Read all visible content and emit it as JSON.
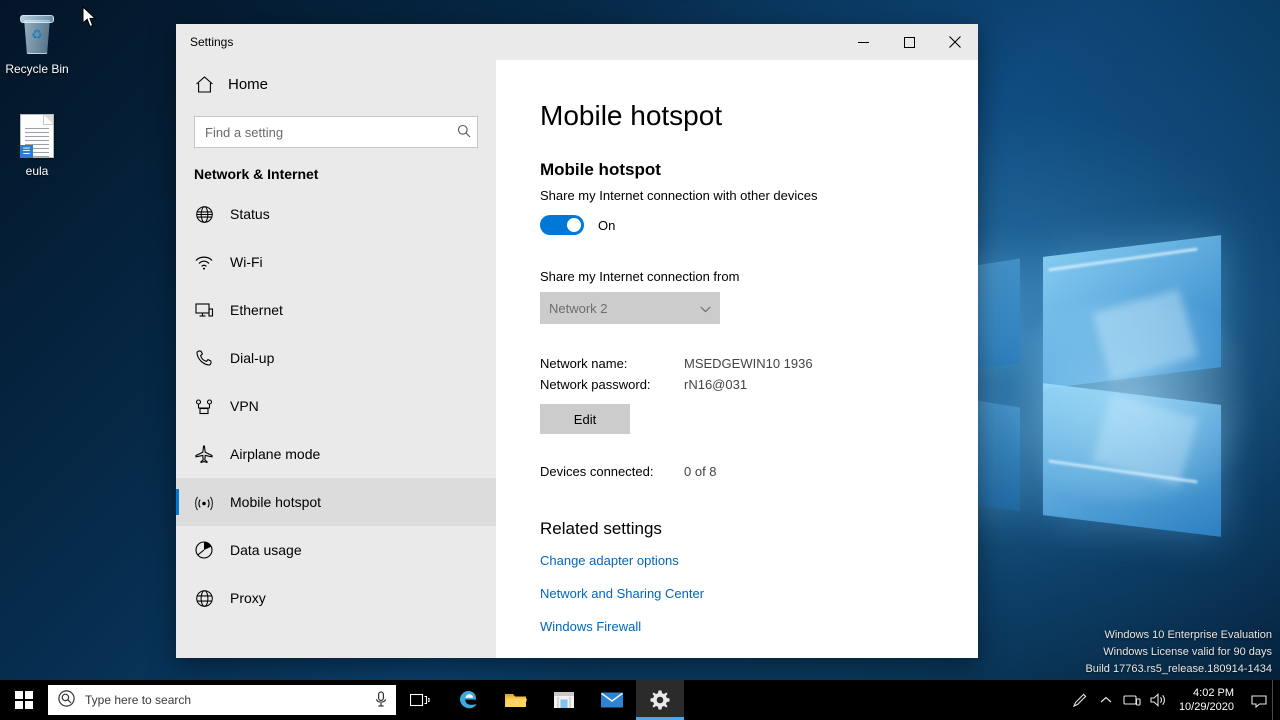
{
  "desktop": {
    "icons": [
      {
        "name": "Recycle Bin",
        "icon": "recycle-bin-icon"
      },
      {
        "name": "eula",
        "icon": "text-document-icon"
      }
    ],
    "watermark": [
      "Windows 10 Enterprise Evaluation",
      "Windows License valid for 90 days",
      "Build 17763.rs5_release.180914-1434"
    ]
  },
  "window": {
    "title": "Settings",
    "controls": {
      "minimize": "—",
      "maximize": "☐",
      "close": "✕"
    }
  },
  "sidebar": {
    "home_label": "Home",
    "search": {
      "placeholder": "Find a setting",
      "value": "",
      "icon": "search-icon"
    },
    "category": "Network & Internet",
    "items": [
      {
        "label": "Status",
        "icon": "globe-icon",
        "selected": false
      },
      {
        "label": "Wi-Fi",
        "icon": "wifi-icon",
        "selected": false
      },
      {
        "label": "Ethernet",
        "icon": "ethernet-icon",
        "selected": false
      },
      {
        "label": "Dial-up",
        "icon": "dialup-phone-icon",
        "selected": false
      },
      {
        "label": "VPN",
        "icon": "vpn-icon",
        "selected": false
      },
      {
        "label": "Airplane mode",
        "icon": "airplane-icon",
        "selected": false
      },
      {
        "label": "Mobile hotspot",
        "icon": "hotspot-broadcast-icon",
        "selected": true
      },
      {
        "label": "Data usage",
        "icon": "data-usage-pie-icon",
        "selected": false
      },
      {
        "label": "Proxy",
        "icon": "proxy-globe-icon",
        "selected": false
      }
    ]
  },
  "main": {
    "page_title": "Mobile hotspot",
    "section_heading": "Mobile hotspot",
    "section_sub": "Share my Internet connection with other devices",
    "toggle": {
      "state_label": "On",
      "on": true,
      "accent": "#0078d7"
    },
    "share_from_label": "Share my Internet connection from",
    "share_from_value": "Network 2",
    "details": [
      {
        "key": "Network name:",
        "value": "MSEDGEWIN10 1936"
      },
      {
        "key": "Network password:",
        "value": "rN16@031"
      }
    ],
    "edit_button": "Edit",
    "devices": {
      "key": "Devices connected:",
      "value": "0 of 8"
    },
    "related_title": "Related settings",
    "related_links": [
      "Change adapter options",
      "Network and Sharing Center",
      "Windows Firewall"
    ],
    "link_color": "#0067b8"
  },
  "taskbar": {
    "start_icon": "windows-start-icon",
    "search_placeholder": "Type here to search",
    "search_icon": "search-circle-icon",
    "mic_icon": "microphone-icon",
    "buttons": [
      {
        "name": "task-view",
        "icon": "task-view-icon"
      },
      {
        "name": "microsoft-edge",
        "icon": "edge-icon"
      },
      {
        "name": "file-explorer",
        "icon": "folder-icon"
      },
      {
        "name": "microsoft-store",
        "icon": "store-icon"
      },
      {
        "name": "mail",
        "icon": "mail-icon"
      },
      {
        "name": "settings",
        "icon": "gear-icon",
        "active": true
      }
    ],
    "tray": [
      {
        "name": "pen-menu",
        "icon": "pen-icon"
      },
      {
        "name": "show-hidden-icons",
        "icon": "chevron-up-icon"
      },
      {
        "name": "network",
        "icon": "network-icon"
      },
      {
        "name": "volume",
        "icon": "speaker-icon"
      },
      {
        "name": "action-center",
        "icon": "notification-icon"
      }
    ],
    "clock": {
      "time": "4:02 PM",
      "date": "10/29/2020"
    }
  }
}
